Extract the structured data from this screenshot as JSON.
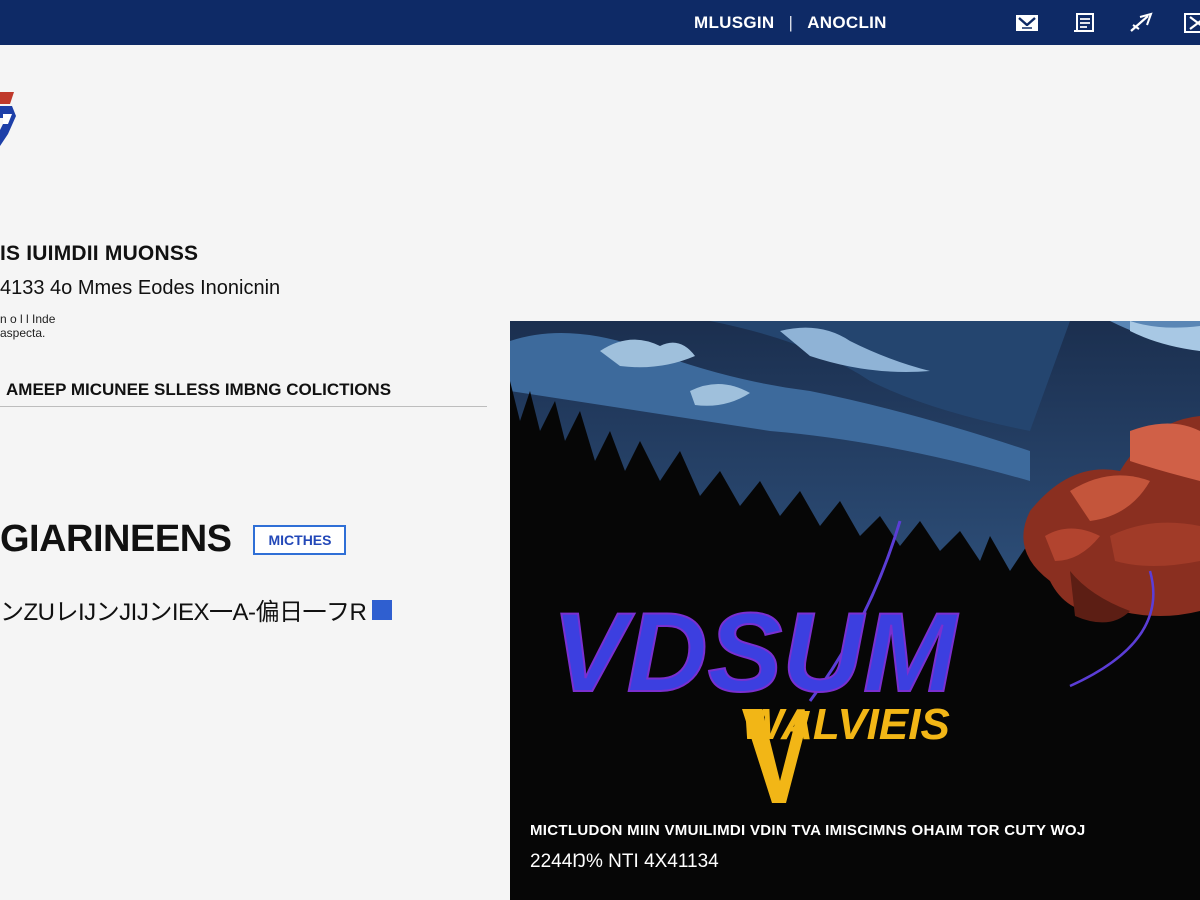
{
  "header": {
    "nav": [
      "MLUSGIN",
      "ANOCLIN"
    ],
    "separator": "|",
    "icons": [
      "inbox-icon",
      "document-icon",
      "edit-icon",
      "close-icon"
    ]
  },
  "main": {
    "title": "IS IUIMDII MUONSS",
    "subtitle": "4133 4o Mmes Eodes Inonicnin",
    "note": "n o l l Inde aspecta.",
    "section_title": "AMEEP MICUNEE SLLESS IMBNG COLICTIONS",
    "heading": "GIARINEENS",
    "badge": "MICTHES",
    "code": "ンZUレIJンJIJンIEX一A-偏日一フR"
  },
  "panel": {
    "logo_text": "VDSUM",
    "logo_sub": "WALVIEIS",
    "caption": "MICTLUDON MIIN VMUILIMDI VDIN TVA IMISCIMNS OHAIM TOR CUTY WOJ",
    "stat": "2244Ŋ% NTI 4X41134"
  },
  "colors": {
    "topbar": "#0e2a66",
    "accent_blue": "#2f6fd6",
    "logo_blue": "#3c3fe0",
    "logo_gold": "#f2b616",
    "muscle_red": "#b8402a"
  }
}
